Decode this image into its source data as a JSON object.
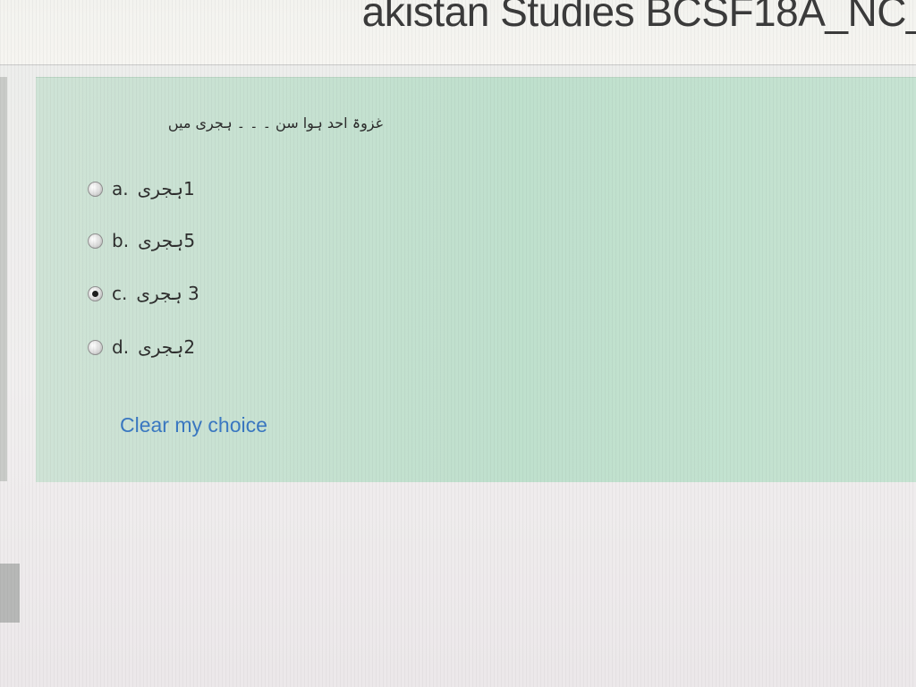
{
  "page": {
    "title": "akistan Studies BCSF18A_NC_"
  },
  "question": {
    "text": "غزوۃ احد ہوا سن ۔ ۔ ۔ ہجری میں",
    "options": [
      {
        "letter": "a. ",
        "text": "1ہجری",
        "selected": false
      },
      {
        "letter": "b. ",
        "text": "5ہجری",
        "selected": false
      },
      {
        "letter": "c. ",
        "text": "3 ہجری",
        "selected": true
      },
      {
        "letter": "d. ",
        "text": "2ہجری",
        "selected": false
      }
    ],
    "clear_label": "Clear my choice"
  },
  "colors": {
    "panel_bg": "#c2e0cf",
    "link": "#3a78c2",
    "header_bg": "#f4f3ef"
  }
}
